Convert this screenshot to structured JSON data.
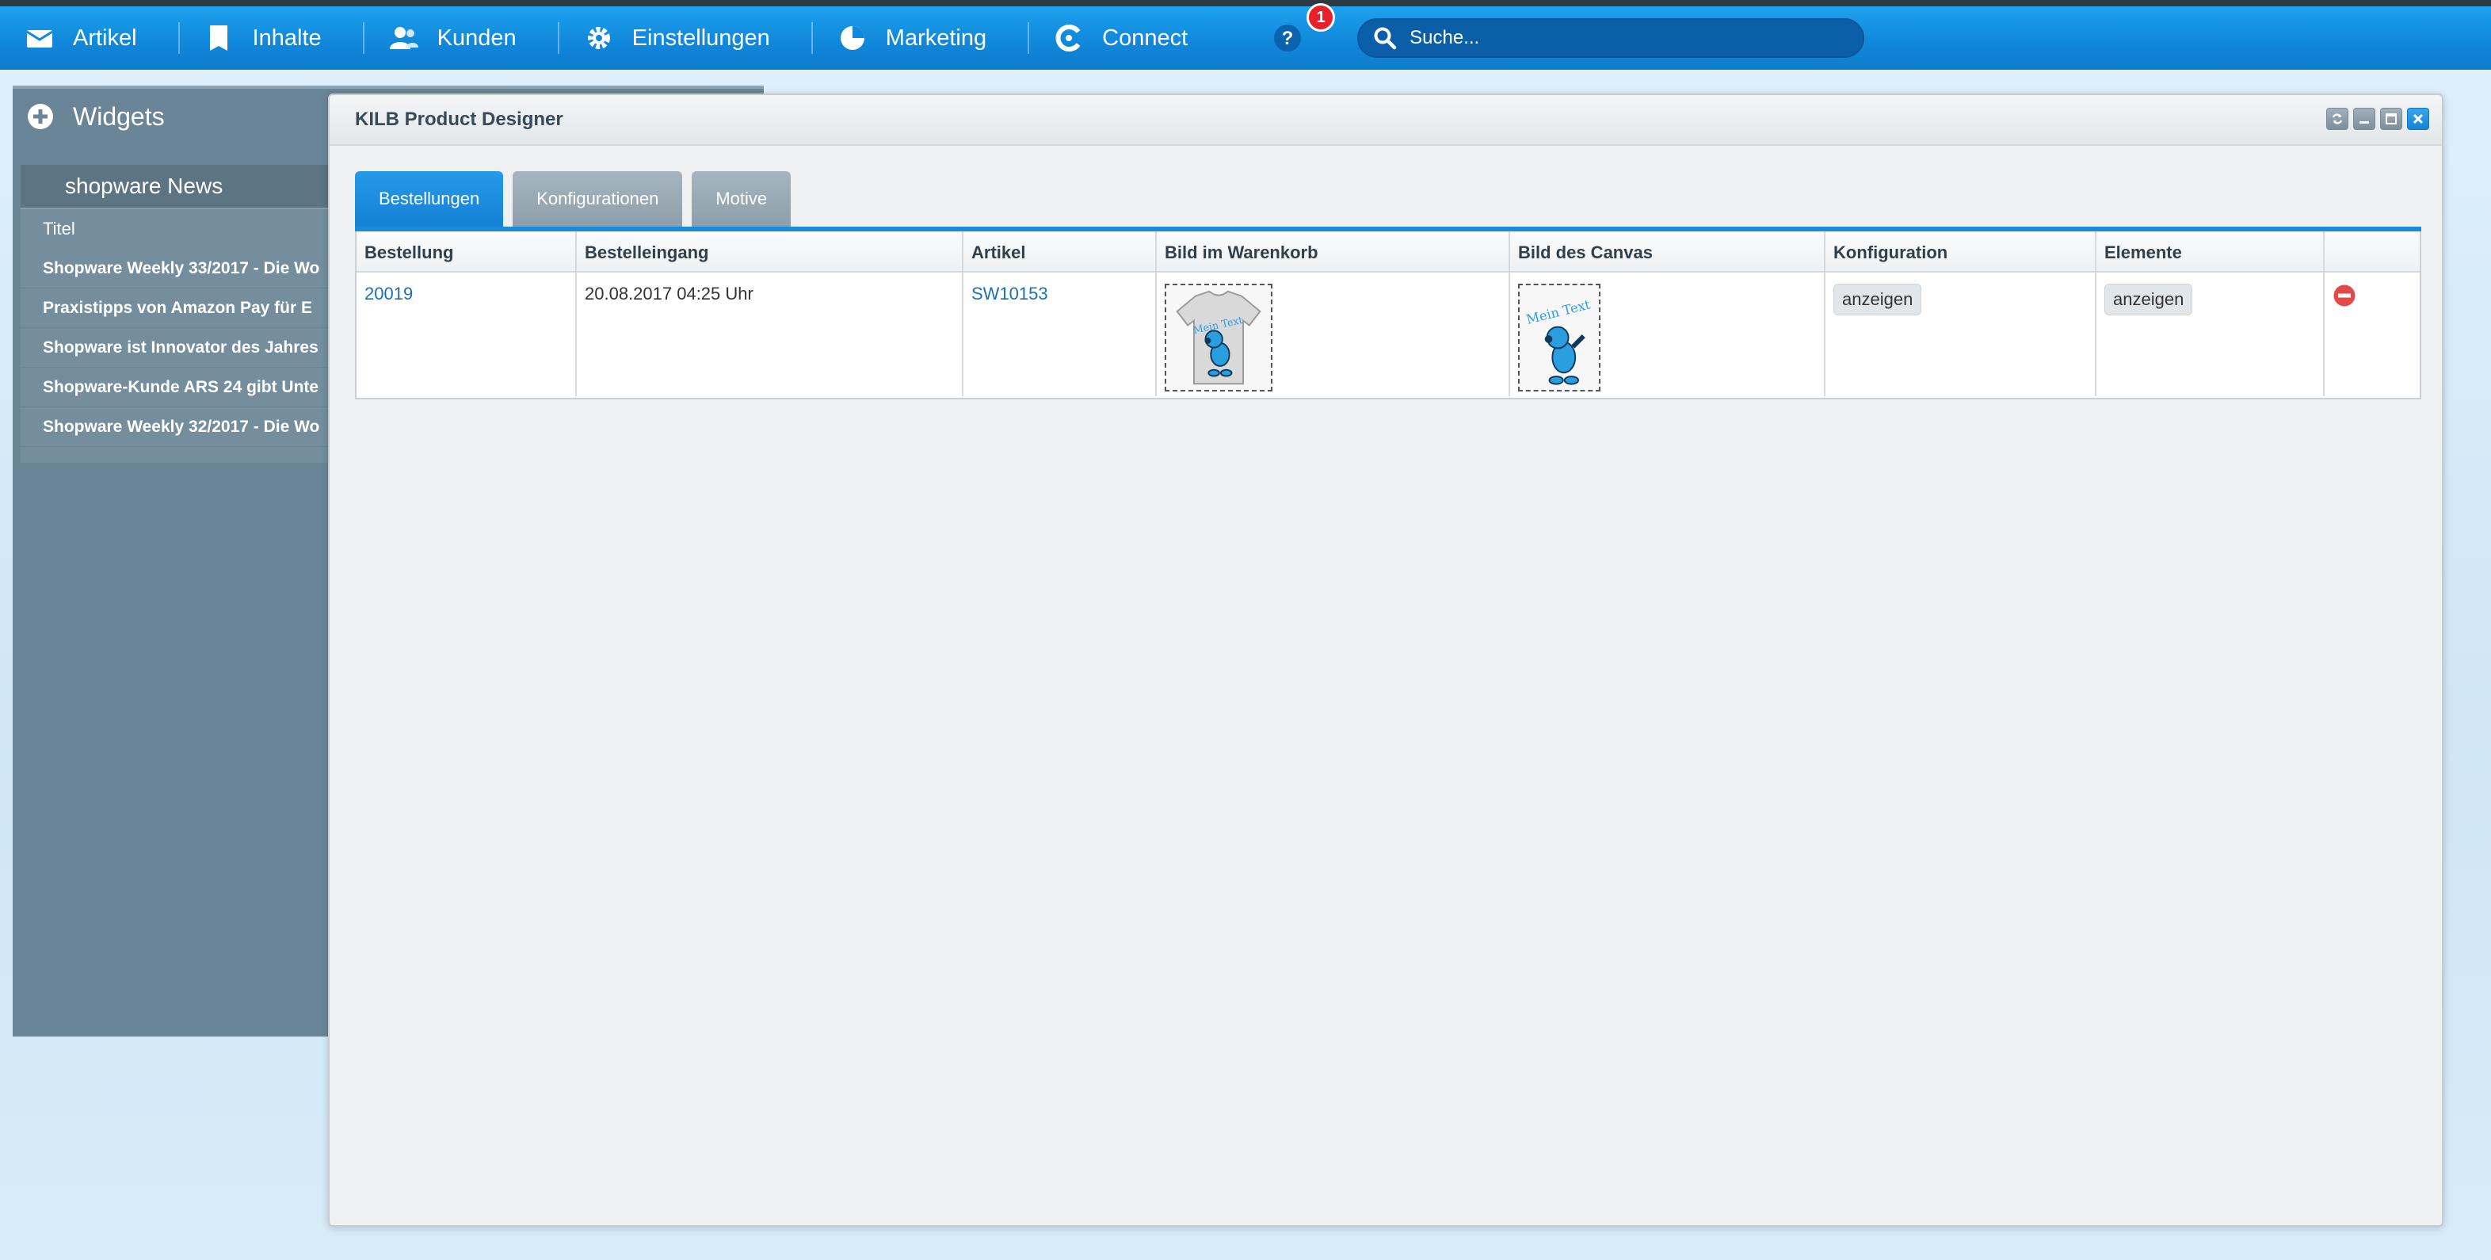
{
  "nav": {
    "items": [
      {
        "label": "Artikel",
        "icon": "inbox-icon"
      },
      {
        "label": "Inhalte",
        "icon": "document-icon"
      },
      {
        "label": "Kunden",
        "icon": "users-icon"
      },
      {
        "label": "Einstellungen",
        "icon": "gear-icon"
      },
      {
        "label": "Marketing",
        "icon": "pie-chart-icon"
      },
      {
        "label": "Connect",
        "icon": "connect-icon"
      }
    ],
    "help_badge": "1",
    "search_placeholder": "Suche..."
  },
  "widgets": {
    "title": "Widgets",
    "news": {
      "title": "shopware News",
      "column": "Titel",
      "rows": [
        "Shopware Weekly 33/2017 - Die Wo",
        "Praxistipps von Amazon Pay für E",
        "Shopware ist Innovator des Jahres",
        "Shopware-Kunde ARS 24 gibt Unte",
        "Shopware Weekly 32/2017 - Die Wo"
      ]
    }
  },
  "window": {
    "title": "KILB Product Designer",
    "tabs": [
      "Bestellungen",
      "Konfigurationen",
      "Motive"
    ],
    "columns": [
      "Bestellung",
      "Bestelleingang",
      "Artikel",
      "Bild im Warenkorb",
      "Bild des Canvas",
      "Konfiguration",
      "Elemente",
      ""
    ],
    "rows": [
      {
        "order": "20019",
        "received": "20.08.2017 04:25 Uhr",
        "article": "SW10153",
        "cart_image_text": "Mein Text",
        "canvas_image_text": "Mein Text",
        "config_label": "anzeigen",
        "elements_label": "anzeigen"
      }
    ]
  },
  "colors": {
    "nav_blue": "#1188db",
    "accent": "#1a8ade",
    "delete_red": "#e24a4a"
  }
}
